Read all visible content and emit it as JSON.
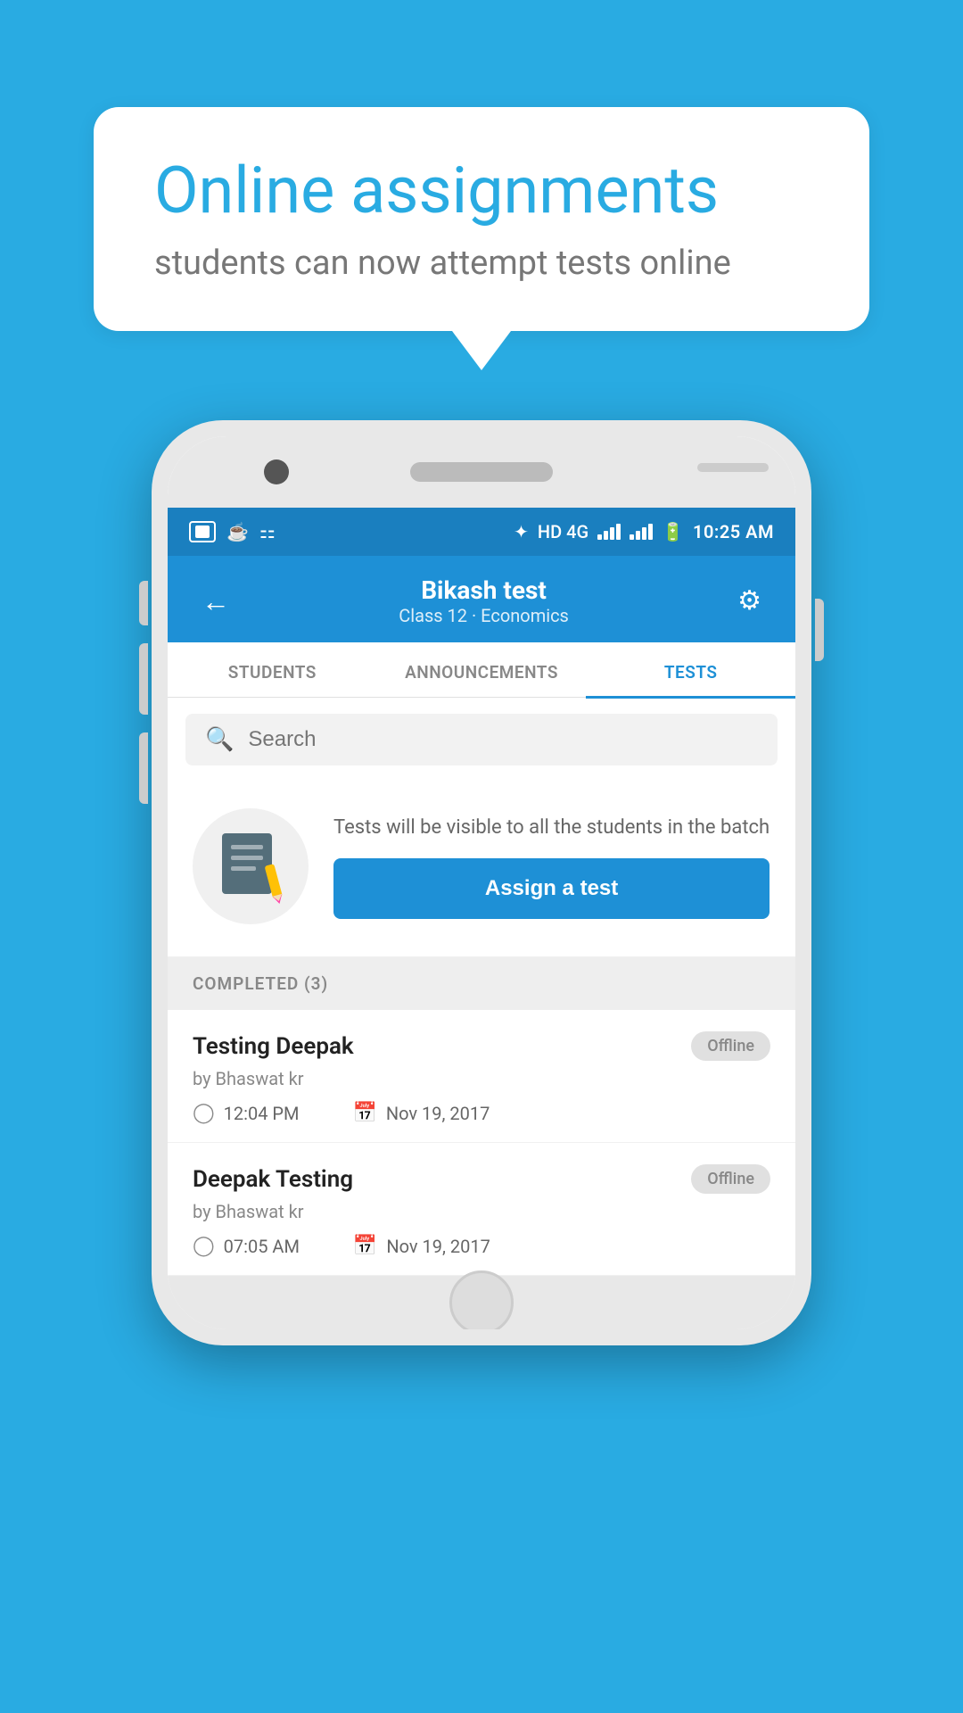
{
  "bubble": {
    "title": "Online assignments",
    "subtitle": "students can now attempt tests online"
  },
  "status_bar": {
    "time": "10:25 AM",
    "network": "HD 4G"
  },
  "header": {
    "title": "Bikash test",
    "subtitle": "Class 12 · Economics",
    "back_label": "←",
    "gear_label": "⚙"
  },
  "tabs": [
    {
      "label": "STUDENTS",
      "active": false
    },
    {
      "label": "ANNOUNCEMENTS",
      "active": false
    },
    {
      "label": "TESTS",
      "active": true
    }
  ],
  "search": {
    "placeholder": "Search"
  },
  "assign_section": {
    "info_text": "Tests will be visible to all the students in the batch",
    "button_label": "Assign a test"
  },
  "completed_section": {
    "header": "COMPLETED (3)",
    "items": [
      {
        "name": "Testing Deepak",
        "by": "by Bhaswat kr",
        "time": "12:04 PM",
        "date": "Nov 19, 2017",
        "badge": "Offline"
      },
      {
        "name": "Deepak Testing",
        "by": "by Bhaswat kr",
        "time": "07:05 AM",
        "date": "Nov 19, 2017",
        "badge": "Offline"
      }
    ]
  }
}
